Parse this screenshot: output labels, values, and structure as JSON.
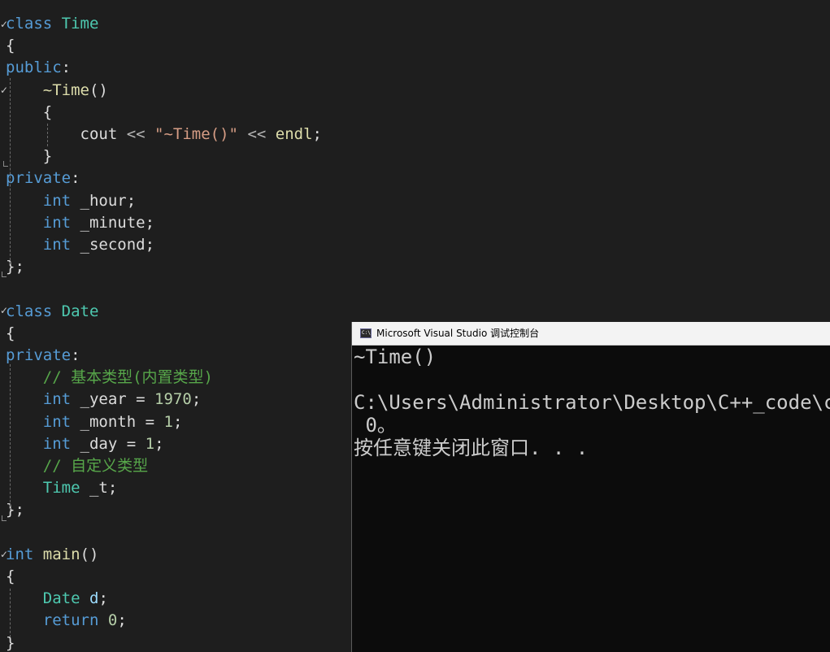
{
  "editor": {
    "lines": [
      [
        {
          "t": "class",
          "c": "kw"
        },
        {
          "t": " ",
          "c": "txt"
        },
        {
          "t": "Time",
          "c": "type"
        }
      ],
      [
        {
          "t": "{",
          "c": "txt"
        }
      ],
      [
        {
          "t": "public",
          "c": "kw"
        },
        {
          "t": ":",
          "c": "txt"
        }
      ],
      [
        {
          "t": "    ",
          "c": "txt"
        },
        {
          "t": "~Time",
          "c": "func"
        },
        {
          "t": "()",
          "c": "txt"
        }
      ],
      [
        {
          "t": "    {",
          "c": "txt"
        }
      ],
      [
        {
          "t": "        ",
          "c": "txt"
        },
        {
          "t": "cout",
          "c": "txt"
        },
        {
          "t": " << ",
          "c": "op"
        },
        {
          "t": "\"~Time()\"",
          "c": "str"
        },
        {
          "t": " << ",
          "c": "op"
        },
        {
          "t": "endl",
          "c": "func"
        },
        {
          "t": ";",
          "c": "txt"
        }
      ],
      [
        {
          "t": "    }",
          "c": "txt"
        }
      ],
      [
        {
          "t": "private",
          "c": "kw"
        },
        {
          "t": ":",
          "c": "txt"
        }
      ],
      [
        {
          "t": "    ",
          "c": "txt"
        },
        {
          "t": "int",
          "c": "kw"
        },
        {
          "t": " _hour;",
          "c": "txt"
        }
      ],
      [
        {
          "t": "    ",
          "c": "txt"
        },
        {
          "t": "int",
          "c": "kw"
        },
        {
          "t": " _minute;",
          "c": "txt"
        }
      ],
      [
        {
          "t": "    ",
          "c": "txt"
        },
        {
          "t": "int",
          "c": "kw"
        },
        {
          "t": " _second;",
          "c": "txt"
        }
      ],
      [
        {
          "t": "};",
          "c": "txt"
        }
      ],
      [],
      [
        {
          "t": "class",
          "c": "kw"
        },
        {
          "t": " ",
          "c": "txt"
        },
        {
          "t": "Date",
          "c": "type"
        }
      ],
      [
        {
          "t": "{",
          "c": "txt"
        }
      ],
      [
        {
          "t": "private",
          "c": "kw"
        },
        {
          "t": ":",
          "c": "txt"
        }
      ],
      [
        {
          "t": "    ",
          "c": "txt"
        },
        {
          "t": "// 基本类型(内置类型)",
          "c": "com"
        }
      ],
      [
        {
          "t": "    ",
          "c": "txt"
        },
        {
          "t": "int",
          "c": "kw"
        },
        {
          "t": " _year = ",
          "c": "txt"
        },
        {
          "t": "1970",
          "c": "num"
        },
        {
          "t": ";",
          "c": "txt"
        }
      ],
      [
        {
          "t": "    ",
          "c": "txt"
        },
        {
          "t": "int",
          "c": "kw"
        },
        {
          "t": " _month = ",
          "c": "txt"
        },
        {
          "t": "1",
          "c": "num"
        },
        {
          "t": ";",
          "c": "txt"
        }
      ],
      [
        {
          "t": "    ",
          "c": "txt"
        },
        {
          "t": "int",
          "c": "kw"
        },
        {
          "t": " _day = ",
          "c": "txt"
        },
        {
          "t": "1",
          "c": "num"
        },
        {
          "t": ";",
          "c": "txt"
        }
      ],
      [
        {
          "t": "    ",
          "c": "txt"
        },
        {
          "t": "// 自定义类型",
          "c": "com"
        }
      ],
      [
        {
          "t": "    ",
          "c": "txt"
        },
        {
          "t": "Time",
          "c": "type"
        },
        {
          "t": " _t;",
          "c": "txt"
        }
      ],
      [
        {
          "t": "};",
          "c": "txt"
        }
      ],
      [],
      [
        {
          "t": "int",
          "c": "kw"
        },
        {
          "t": " ",
          "c": "txt"
        },
        {
          "t": "main",
          "c": "func"
        },
        {
          "t": "()",
          "c": "txt"
        }
      ],
      [
        {
          "t": "{",
          "c": "txt"
        }
      ],
      [
        {
          "t": "    ",
          "c": "txt"
        },
        {
          "t": "Date",
          "c": "type"
        },
        {
          "t": " ",
          "c": "txt"
        },
        {
          "t": "d",
          "c": "var"
        },
        {
          "t": ";",
          "c": "txt"
        }
      ],
      [
        {
          "t": "    ",
          "c": "txt"
        },
        {
          "t": "return",
          "c": "kw"
        },
        {
          "t": " ",
          "c": "txt"
        },
        {
          "t": "0",
          "c": "num"
        },
        {
          "t": ";",
          "c": "txt"
        }
      ],
      [
        {
          "t": "}",
          "c": "txt"
        }
      ]
    ]
  },
  "console": {
    "title": "Microsoft Visual Studio 调试控制台",
    "icon_label": "C:\\",
    "icon": "console-window-icon",
    "lines": [
      "~Time()",
      "",
      "C:\\Users\\Administrator\\Desktop\\C++_code\\cp",
      " 0。",
      "按任意键关闭此窗口. . ."
    ]
  },
  "colors": {
    "editor_bg": "#1e1e1e",
    "keyword": "#569cd6",
    "type": "#4ec9b0",
    "function": "#dcdcaa",
    "string": "#d69d85",
    "comment": "#57a64a",
    "number": "#b5cea8",
    "console_bg": "#0c0c0c",
    "console_text": "#cccccc"
  }
}
